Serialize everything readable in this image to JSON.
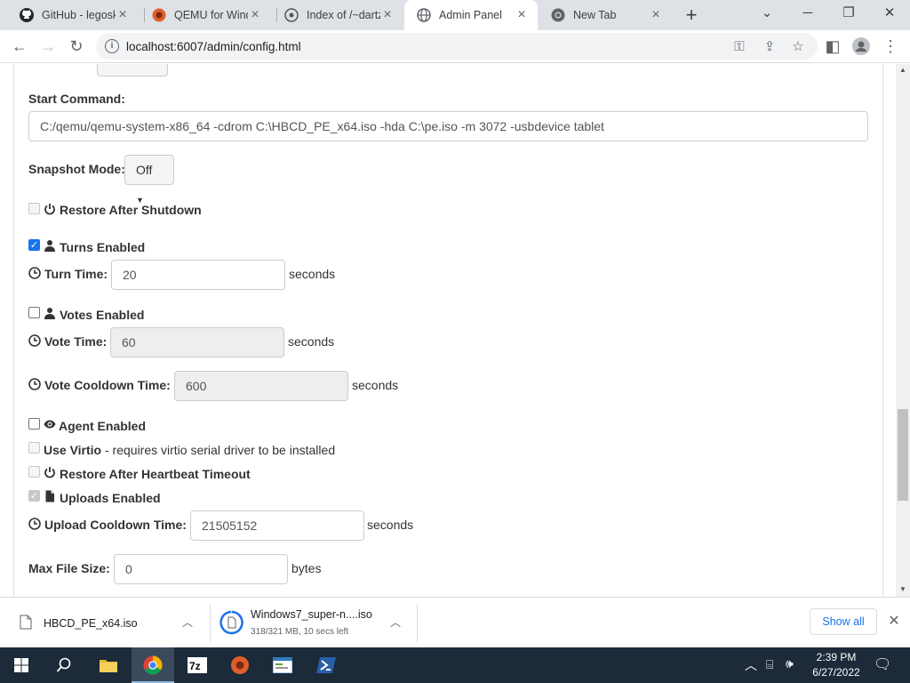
{
  "tabs": [
    {
      "title": "GitHub - legosk",
      "favicon": "github-icon"
    },
    {
      "title": "QEMU for Wind",
      "favicon": "qemu-icon"
    },
    {
      "title": "Index of /~dartz",
      "favicon": "index-icon"
    },
    {
      "title": "Admin Panel",
      "favicon": "globe-icon"
    },
    {
      "title": "New Tab",
      "favicon": "chrome-icon"
    }
  ],
  "address": {
    "url": "localhost:6007/admin/config.html"
  },
  "form": {
    "start_command_label": "Start Command:",
    "start_command_value": "C:/qemu/qemu-system-x86_64 -cdrom C:\\HBCD_PE_x64.iso -hda C:\\pe.iso -m 3072 -usbdevice tablet",
    "snapshot_label": "Snapshot Mode:",
    "snapshot_value": "Off",
    "restore_shutdown_label": "Restore After Shutdown",
    "turns_label": "Turns Enabled",
    "turns_checked": true,
    "turn_time_label": "Turn Time:",
    "turn_time_value": "20",
    "turn_time_unit": "seconds",
    "votes_label": "Votes Enabled",
    "votes_checked": false,
    "vote_time_label": "Vote Time:",
    "vote_time_value": "60",
    "vote_time_unit": "seconds",
    "vote_cooldown_label": "Vote Cooldown Time:",
    "vote_cooldown_value": "600",
    "vote_cooldown_unit": "seconds",
    "agent_label": "Agent Enabled",
    "agent_checked": false,
    "virtio_label": "Use Virtio",
    "virtio_note": " - requires virtio serial driver to be installed",
    "restore_heartbeat_label": "Restore After Heartbeat Timeout",
    "uploads_label": "Uploads Enabled",
    "uploads_checked": true,
    "upload_cooldown_label": "Upload Cooldown Time:",
    "upload_cooldown_value": "21505152",
    "upload_cooldown_unit": "seconds",
    "max_file_label": "Max File Size:",
    "max_file_value": "0",
    "max_file_unit": "bytes"
  },
  "downloads": [
    {
      "name": "HBCD_PE_x64.iso",
      "status": ""
    },
    {
      "name": "Windows7_super-n....iso",
      "status": "318/321 MB, 10 secs left"
    }
  ],
  "downloads_show_all": "Show all",
  "taskbar": {
    "time": "2:39 PM",
    "date": "6/27/2022"
  }
}
